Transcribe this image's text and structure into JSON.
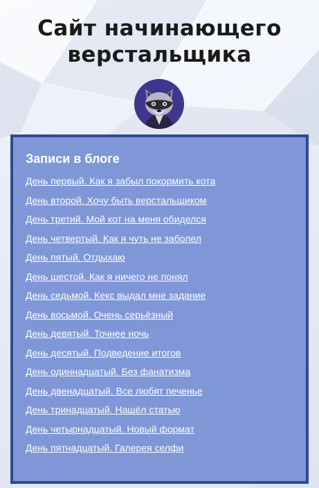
{
  "header": {
    "title_line1": "Сайт начинающего",
    "title_line2": "верстальщика"
  },
  "avatar": {
    "icon": "raccoon-icon"
  },
  "blog": {
    "heading": "Записи в блоге",
    "posts": [
      "День первый. Как я забыл покормить кота",
      "День второй. Хочу быть верстальщиком",
      "День третий. Мой кот на меня обиделся",
      "День четвертый. Как я чуть не заболел",
      "День пятый. Отдыхаю",
      "День шестой. Как я ничего не понял",
      "День седьмой. Кекс выдал мне задание",
      "День восьмой. Очень серьёзный",
      "День девятый. Точнее ночь",
      "День десятый. Подведение итогов",
      "День одиннадцатый. Без фанатизма",
      "День двенадцатый. Все любят печенье",
      "День тринадцатый. Нашёл статью",
      "День четырнадцатый. Новый формат",
      "День пятнадцатый. Галерея селфи"
    ]
  },
  "colors": {
    "panel_background": "#7f97d6",
    "panel_border": "#2f4a94",
    "title_text": "#1a1a1a",
    "link_text": "#ffffff",
    "avatar_background": "#3f3690"
  }
}
